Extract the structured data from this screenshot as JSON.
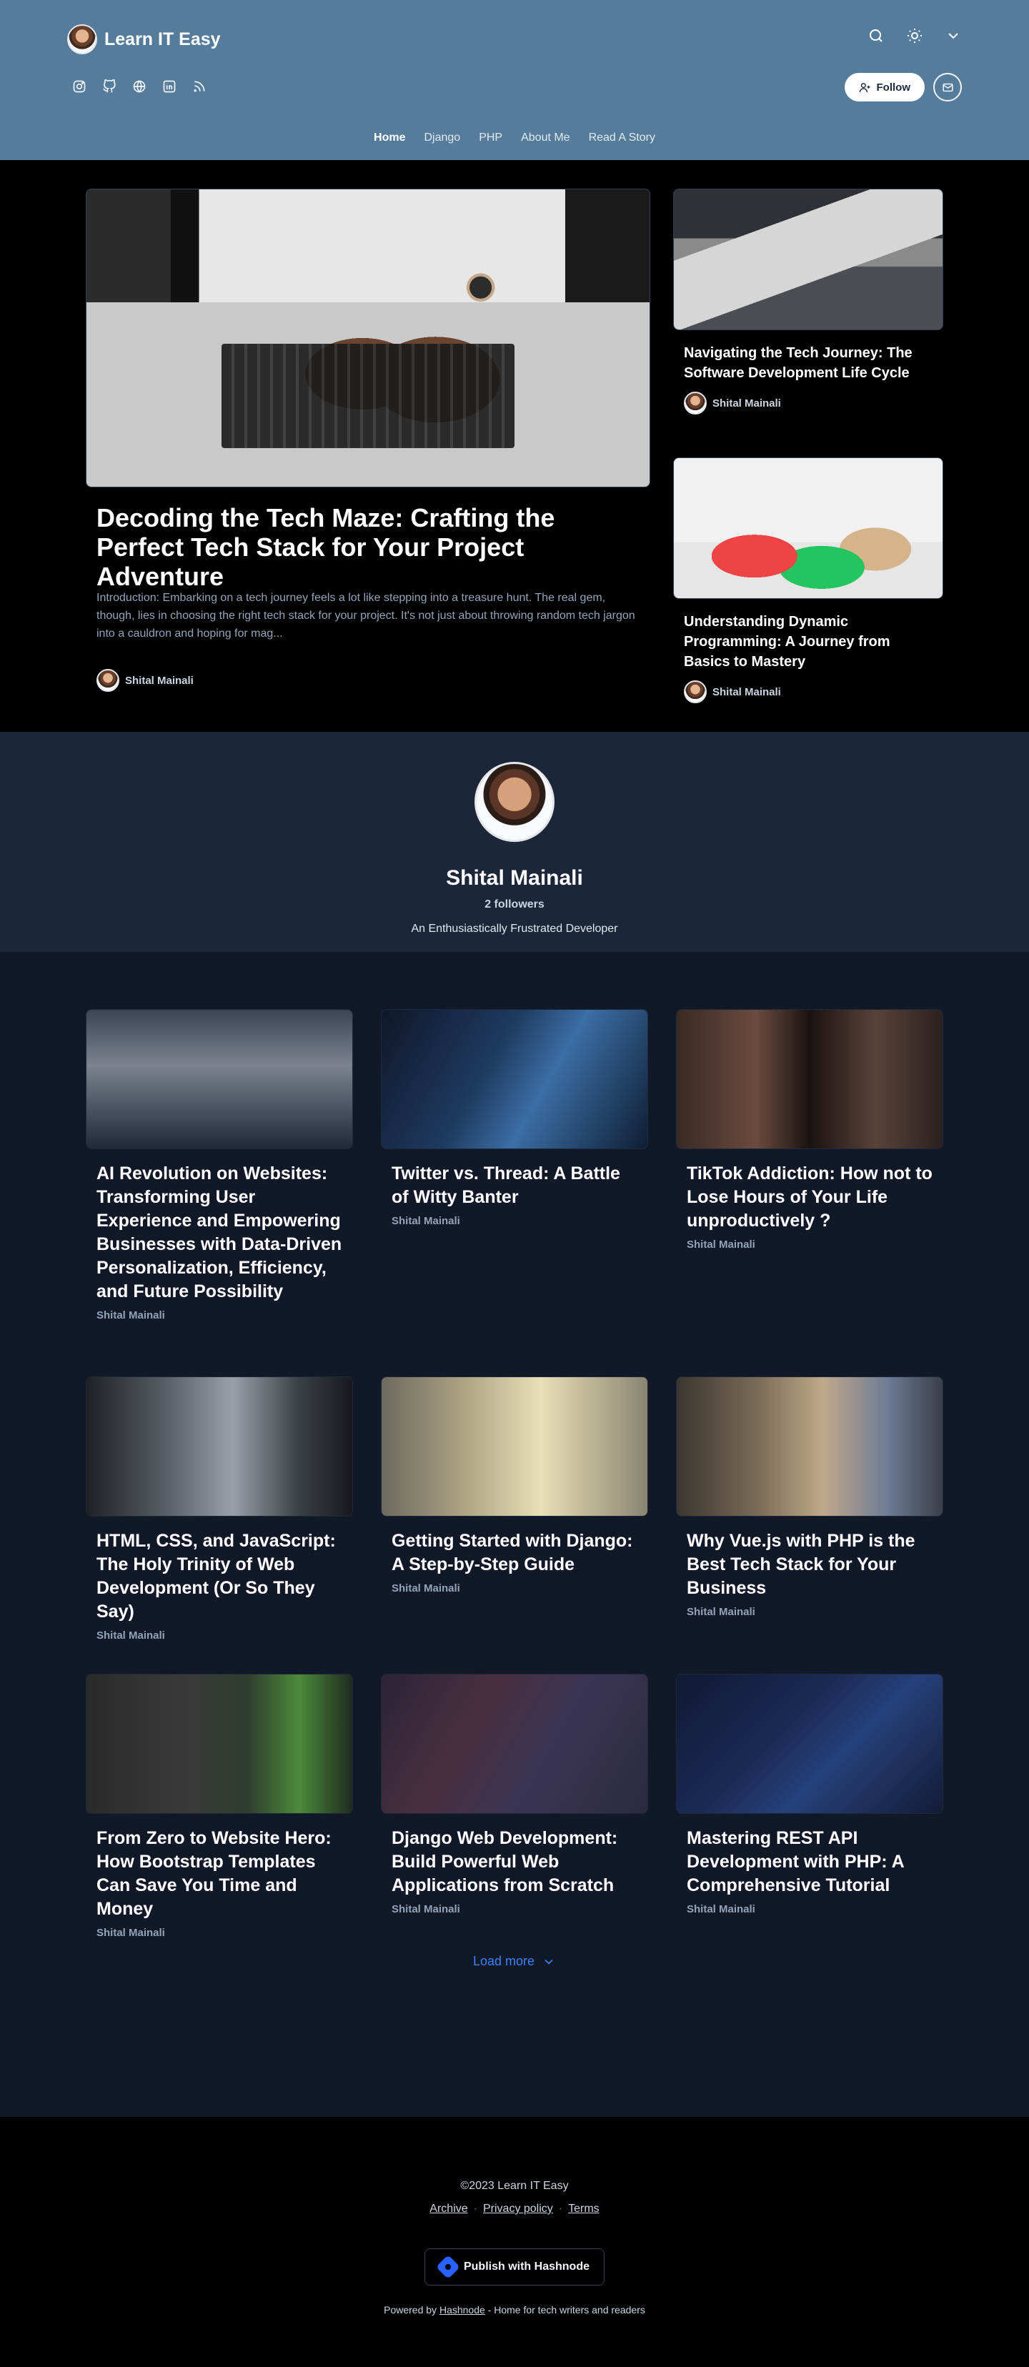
{
  "header": {
    "brand_name": "Learn IT Easy",
    "social_icons": [
      "instagram-icon",
      "github-icon",
      "globe-icon",
      "linkedin-icon",
      "rss-icon"
    ],
    "tool_icons": [
      "search-icon",
      "sun-icon",
      "chevron-down-icon"
    ],
    "follow_label": "Follow",
    "nav": [
      {
        "label": "Home",
        "active": true
      },
      {
        "label": "Django",
        "active": false
      },
      {
        "label": "PHP",
        "active": false
      },
      {
        "label": "About Me",
        "active": false
      },
      {
        "label": "Read A Story",
        "active": false
      }
    ],
    "background_color": "#567c9c"
  },
  "featured": {
    "main": {
      "title": "Decoding the Tech Maze: Crafting the Perfect Tech Stack for Your Project Adventure",
      "excerpt": "Introduction: Embarking on a tech journey feels a lot like stepping into a treasure hunt. The real gem, though, lies in choosing the right tech stack for your project. It's not just about throwing random tech jargon into a cauldron and hoping for mag...",
      "author": "Shital Mainali"
    },
    "side": [
      {
        "title": "Navigating the Tech Journey: The Software Development Life Cycle",
        "author": "Shital Mainali"
      },
      {
        "title": "Understanding Dynamic Programming: A Journey from Basics to Mastery",
        "author": "Shital Mainali"
      }
    ]
  },
  "profile": {
    "name": "Shital Mainali",
    "followers": "2 followers",
    "bio": "An Enthusiastically Frustrated Developer"
  },
  "posts": [
    {
      "title": "AI Revolution on Websites: Transforming User Experience and Empowering Businesses with Data-Driven Personalization, Efficiency, and Future Possibility",
      "author": "Shital Mainali"
    },
    {
      "title": "Twitter vs. Thread: A Battle of Witty Banter",
      "author": "Shital Mainali"
    },
    {
      "title": "TikTok Addiction: How not to Lose Hours of Your Life unproductively ?",
      "author": "Shital Mainali"
    },
    {
      "title": "HTML, CSS, and JavaScript: The Holy Trinity of Web Development (Or So They Say)",
      "author": "Shital Mainali"
    },
    {
      "title": "Getting Started with Django: A Step-by-Step Guide",
      "author": "Shital Mainali"
    },
    {
      "title": "Why Vue.js with PHP is the Best Tech Stack for Your Business",
      "author": "Shital Mainali"
    },
    {
      "title": "From Zero to Website Hero: How Bootstrap Templates Can Save You Time and Money",
      "author": "Shital Mainali"
    },
    {
      "title": "Django Web Development: Build Powerful Web Applications from Scratch",
      "author": "Shital Mainali"
    },
    {
      "title": "Mastering REST API Development with PHP: A Comprehensive Tutorial",
      "author": "Shital Mainali"
    }
  ],
  "load_more_label": "Load more",
  "footer": {
    "copyright": "©2023 Learn IT Easy",
    "links": [
      "Archive",
      "Privacy policy",
      "Terms"
    ],
    "publish_label": "Publish with Hashnode",
    "powered_prefix": "Powered by",
    "powered_link": "Hashnode",
    "powered_suffix": "- Home for tech writers and readers"
  }
}
